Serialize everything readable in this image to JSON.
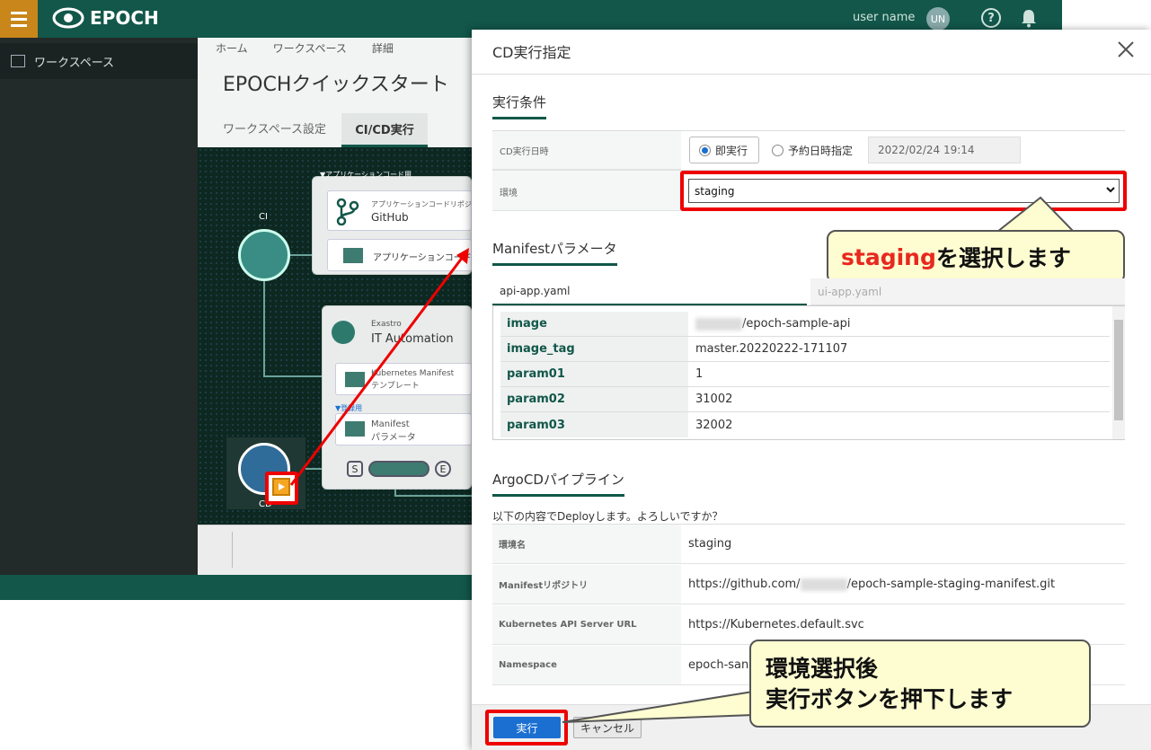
{
  "header": {
    "brand": "EPOCH",
    "user_name": "user name",
    "user_initials": "UN",
    "help_glyph": "?"
  },
  "sidebar": {
    "workspace_label": "ワークスペース"
  },
  "main": {
    "breadcrumb": [
      "ホーム",
      "ワークスペース",
      "詳細"
    ],
    "title": "EPOCHクイックスタート",
    "tabs": [
      "ワークスペース設定",
      "CI/CD実行"
    ]
  },
  "pipeline": {
    "app_code_header": "▼アプリケーションコード用",
    "repo_caption": "アプリケーションコードリポジトリ",
    "repo_name": "GitHub",
    "app_code_item": "アプリケーションコード",
    "ci_label": "CI",
    "cd_label": "CD",
    "ita_vendor": "Exastro",
    "ita_name": "IT Automation",
    "k8s_line1": "Kubernetes Manifest",
    "k8s_line2": "テンプレート",
    "manifest_sub_header": "▼登録用",
    "manifest_line1": "Manifest",
    "manifest_line2": "パラメータ",
    "stage_s": "S",
    "stage_e": "E"
  },
  "modal": {
    "title": "CD実行指定",
    "section_exec": "実行条件",
    "cd_datetime_label": "CD実行日時",
    "radio_now": "即実行",
    "radio_scheduled": "予約日時指定",
    "scheduled_value": "2022/02/24 19:14",
    "env_label": "環境",
    "env_value": "staging",
    "section_manifest": "Manifestパラメータ",
    "manifest_tabs": [
      "api-app.yaml",
      "ui-app.yaml"
    ],
    "params": [
      {
        "key": "image",
        "value": "/epoch-sample-api"
      },
      {
        "key": "image_tag",
        "value": "master.20220222-171107"
      },
      {
        "key": "param01",
        "value": "1"
      },
      {
        "key": "param02",
        "value": "31002"
      },
      {
        "key": "param03",
        "value": "32002"
      }
    ],
    "section_argocd": "ArgoCDパイプライン",
    "confirm_text": "以下の内容でDeployします。よろしいですか？",
    "info": [
      {
        "key": "環境名",
        "value": "staging"
      },
      {
        "key": "Manifestリポジトリ",
        "value_prefix": "https://github.com/",
        "value_suffix": "/epoch-sample-staging-manifest.git"
      },
      {
        "key": "Kubernetes API Server URL",
        "value": "https://Kubernetes.default.svc"
      },
      {
        "key": "Namespace",
        "value": "epoch-san"
      }
    ],
    "exec_button": "実行",
    "cancel_button": "キャンセル"
  },
  "callouts": {
    "select_prefix": "staging",
    "select_suffix": "を選択します",
    "exec_line1": "環境選択後",
    "exec_line2": "実行ボタンを押下します"
  },
  "colors": {
    "header_bg": "#12574a",
    "accent": "#12574a",
    "highlight": "#ee0000",
    "primary_button": "#1a6fd1",
    "callout_bg": "#fefcd1"
  }
}
